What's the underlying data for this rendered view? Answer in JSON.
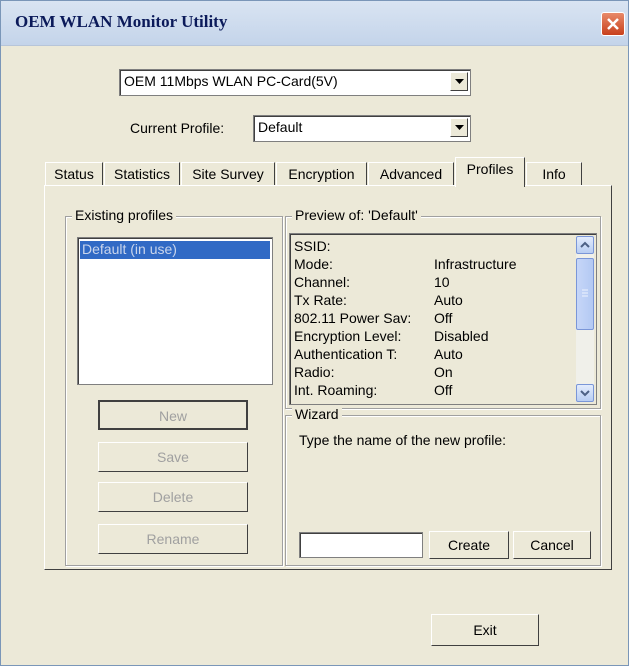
{
  "window": {
    "title": "OEM WLAN Monitor Utility"
  },
  "adapter": {
    "selected": "OEM 11Mbps WLAN PC-Card(5V)"
  },
  "profile_select": {
    "label": "Current Profile:",
    "selected": "Default"
  },
  "tabs": [
    {
      "label": "Status"
    },
    {
      "label": "Statistics"
    },
    {
      "label": "Site Survey"
    },
    {
      "label": "Encryption"
    },
    {
      "label": "Advanced"
    },
    {
      "label": "Profiles",
      "active": true
    },
    {
      "label": "Info"
    }
  ],
  "existing_profiles": {
    "title": "Existing profiles",
    "items": [
      "Default (in use)"
    ],
    "buttons": {
      "new": "New",
      "save": "Save",
      "delete": "Delete",
      "rename": "Rename"
    }
  },
  "preview": {
    "title": "Preview of: 'Default'",
    "rows": [
      {
        "label": "SSID:",
        "value": ""
      },
      {
        "label": "Mode:",
        "value": "Infrastructure"
      },
      {
        "label": "Channel:",
        "value": "10"
      },
      {
        "label": "Tx Rate:",
        "value": "Auto"
      },
      {
        "label": "802.11 Power Sav:",
        "value": "Off"
      },
      {
        "label": "Encryption Level:",
        "value": "Disabled"
      },
      {
        "label": "Authentication T:",
        "value": "Auto"
      },
      {
        "label": "Radio:",
        "value": "On"
      },
      {
        "label": "Int. Roaming:",
        "value": "Off"
      }
    ]
  },
  "wizard": {
    "title": "Wizard",
    "prompt": "Type the name of the new profile:",
    "name_value": "",
    "create_label": "Create",
    "cancel_label": "Cancel"
  },
  "footer": {
    "exit_label": "Exit"
  },
  "colors": {
    "selection": "#316ac5",
    "face": "#ece9d8",
    "title_text": "#0b1a5a",
    "close": "#d0502c"
  }
}
